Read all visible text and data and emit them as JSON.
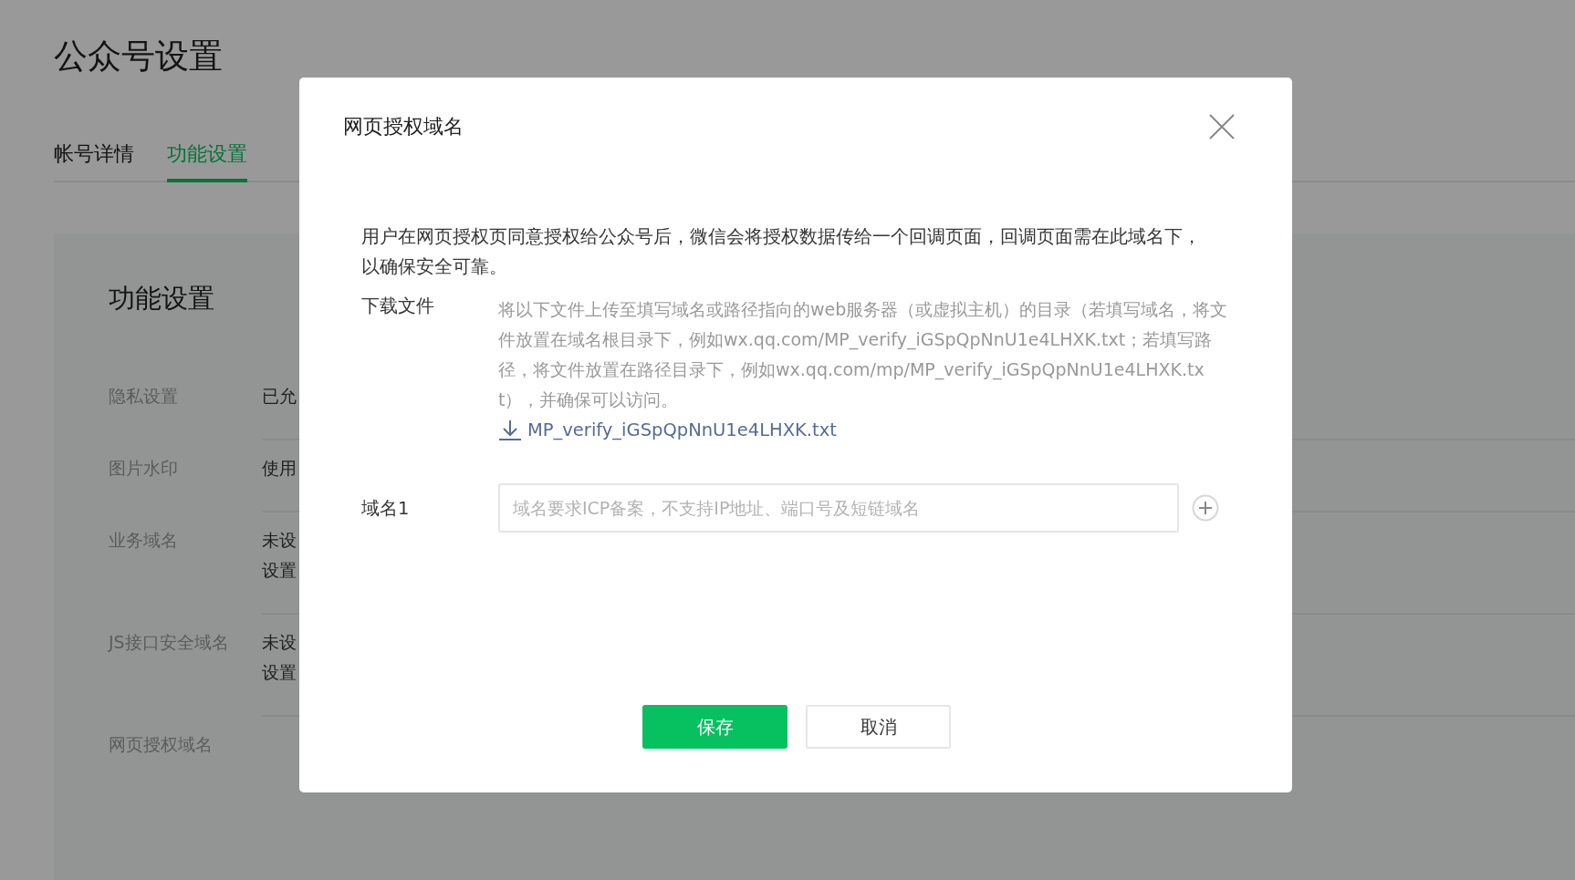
{
  "page": {
    "title": "公众号设置",
    "tabs": [
      {
        "label": "帐号详情",
        "selected": false
      },
      {
        "label": "功能设置",
        "selected": true
      }
    ]
  },
  "section": {
    "title": "功能设置",
    "rows": [
      {
        "label": "隐私设置",
        "value": [
          "已允"
        ]
      },
      {
        "label": "图片水印",
        "value": [
          "使用"
        ]
      },
      {
        "label": "业务域名",
        "value": [
          "未设",
          "设置"
        ]
      },
      {
        "label": "JS接口安全域名",
        "value": [
          "未设",
          "设置"
        ]
      },
      {
        "label": "网页授权域名"
      }
    ]
  },
  "dialog": {
    "title": "网页授权域名",
    "description": "用户在网页授权页同意授权给公众号后，微信会将授权数据传给一个回调页面，回调页面需在此域名下，以确保安全可靠。",
    "download": {
      "label": "下载文件",
      "instructions": "将以下文件上传至填写域名或路径指向的web服务器（或虚拟主机）的目录（若填写域名，将文件放置在域名根目录下，例如wx.qq.com/MP_verify_iGSpQpNnU1e4LHXK.txt；若填写路径，将文件放置在路径目录下，例如wx.qq.com/mp/MP_verify_iGSpQpNnU1e4LHXK.txt），并确保可以访问。",
      "file": "MP_verify_iGSpQpNnU1e4LHXK.txt"
    },
    "domains": [
      {
        "label": "域名1",
        "placeholder": "域名要求ICP备案，不支持IP地址、端口号及短链域名"
      }
    ],
    "buttons": [
      {
        "kind": "primary",
        "label": "保存"
      },
      {
        "kind": "default",
        "label": "取消"
      }
    ]
  }
}
